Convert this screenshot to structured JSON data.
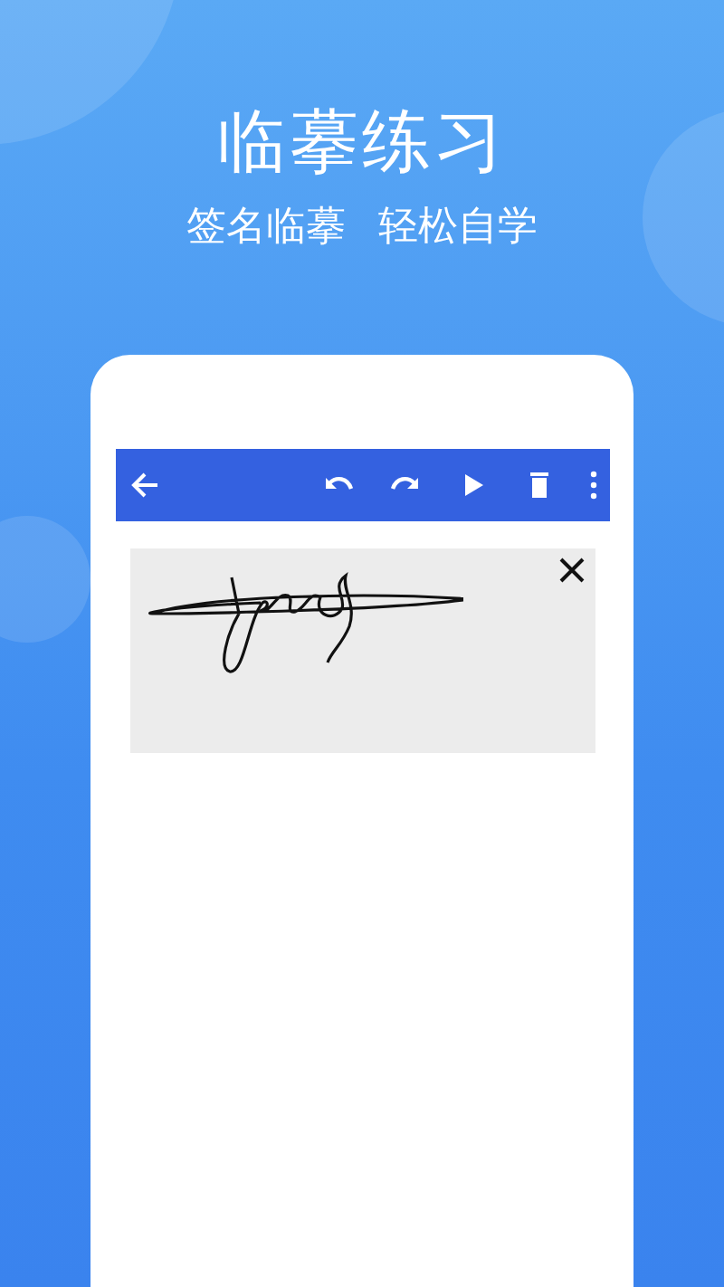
{
  "headline": "临摹练习",
  "taglines": [
    "签名临摹",
    "轻松自学"
  ]
}
